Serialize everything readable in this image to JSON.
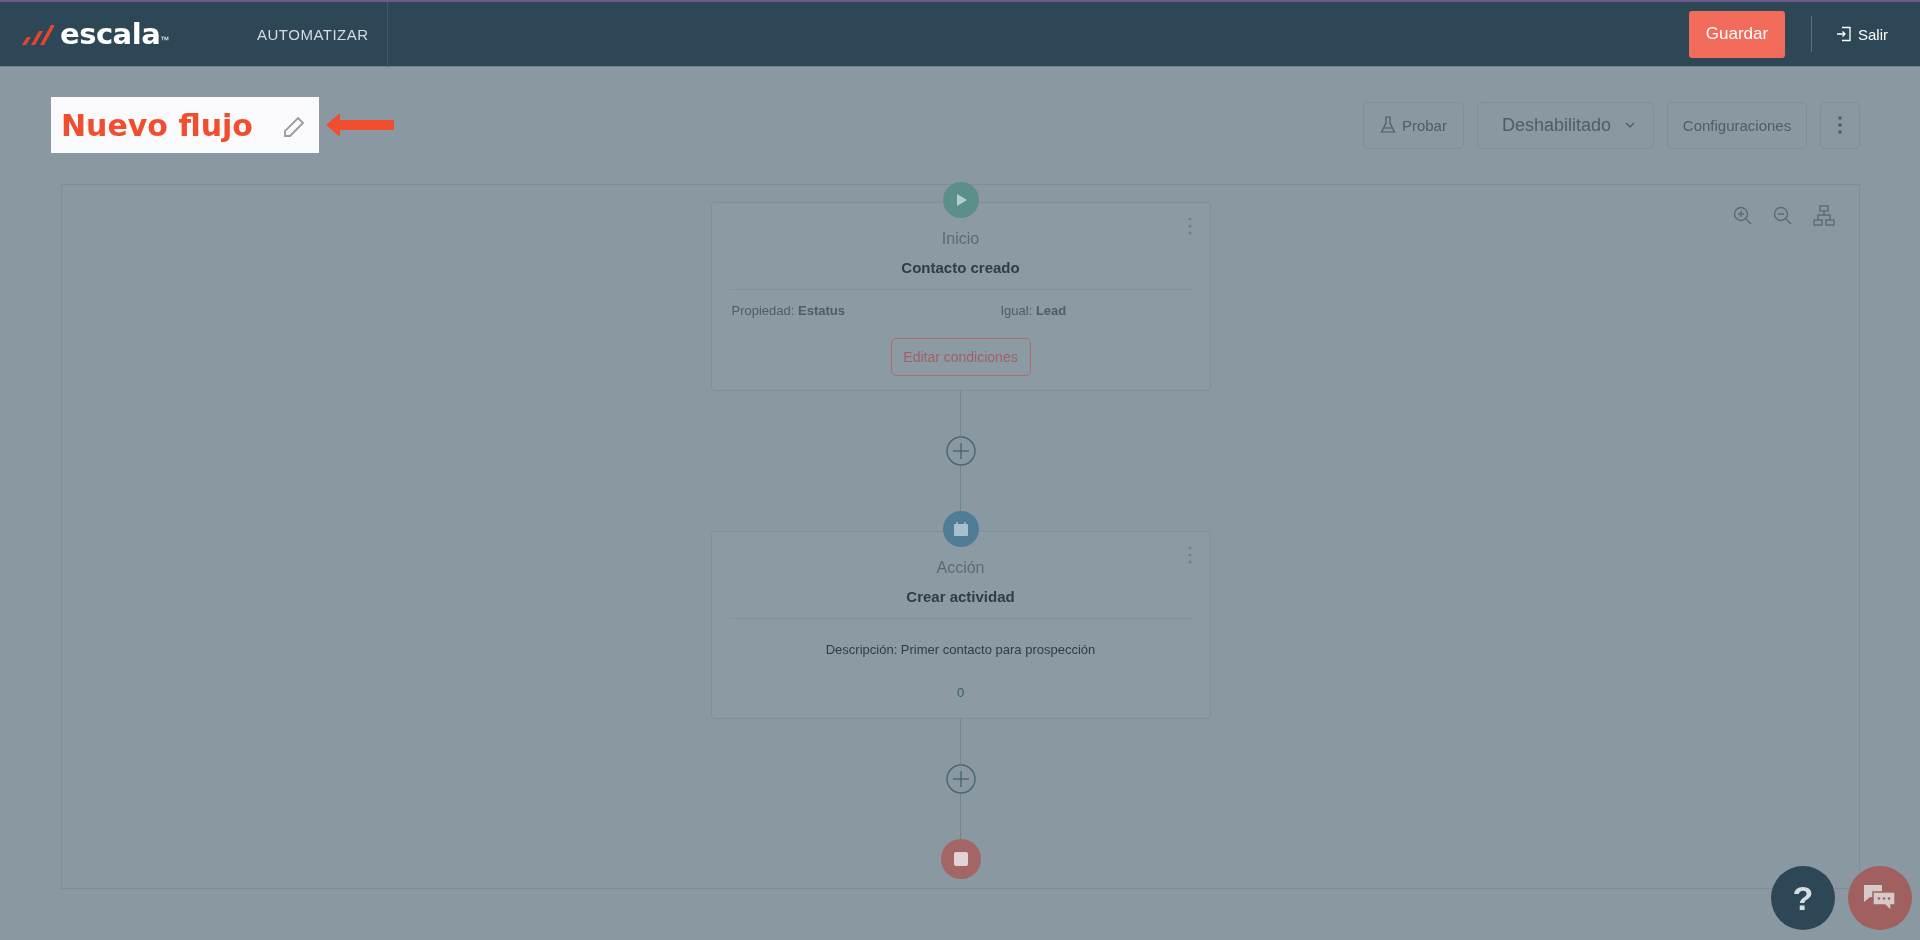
{
  "header": {
    "brand": "escala",
    "brand_mark": "™",
    "nav": [
      "AUTOMATIZAR"
    ],
    "save_button": "Guardar",
    "exit_button": "Salir"
  },
  "flow_title": "Nuevo flujo",
  "toolbar": {
    "test_button": "Probar",
    "status_dropdown": "Deshabilitado",
    "settings_button": "Configuraciones"
  },
  "nodes": [
    {
      "kind": "trigger",
      "type_label": "Inicio",
      "title": "Contacto creado",
      "conditions": [
        "Propiedad: **Estatus**",
        "Igual: **Lead**"
      ],
      "button": "Editar condiciones"
    },
    {
      "kind": "action",
      "type_label": "Acción",
      "title": "Crear actividad",
      "description": "Descripción: Primer contacto para prospección",
      "count": "0"
    }
  ],
  "help_button": "?"
}
